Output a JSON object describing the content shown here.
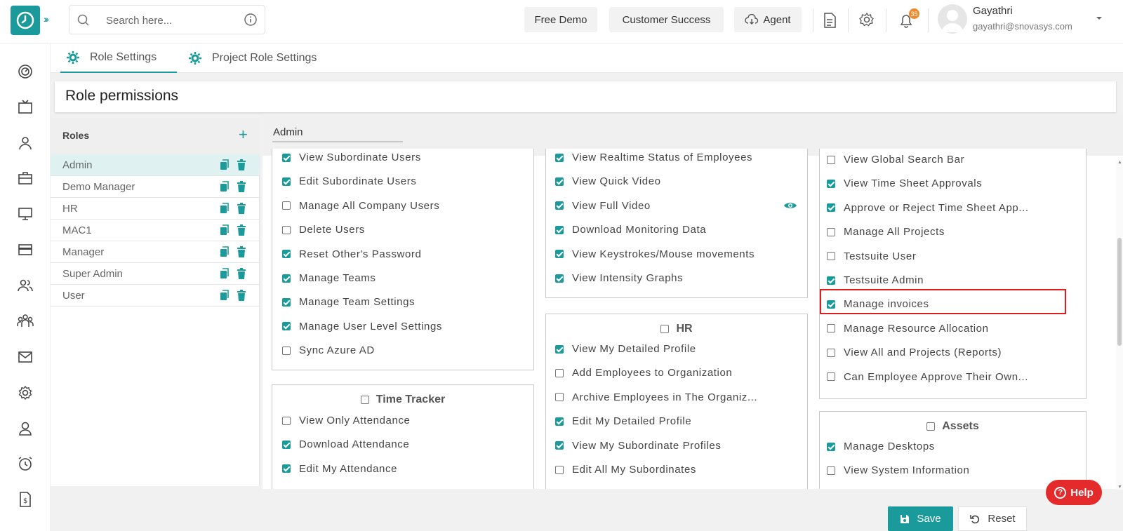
{
  "header": {
    "search_placeholder": "Search here...",
    "buttons": {
      "free_demo": "Free Demo",
      "customer_success": "Customer Success",
      "agent": "Agent"
    },
    "notification_count": "35",
    "user": {
      "name": "Gayathri",
      "email": "gayathri@snovasys.com"
    }
  },
  "tabs": [
    {
      "label": "Role Settings",
      "active": true
    },
    {
      "label": "Project Role Settings",
      "active": false
    }
  ],
  "page_title": "Role permissions",
  "roles_panel": {
    "title": "Roles",
    "roles": [
      "Admin",
      "Demo Manager",
      "HR",
      "MAC1",
      "Manager",
      "Super Admin",
      "User"
    ],
    "selected": "Admin"
  },
  "permissions": {
    "role_name": "Admin",
    "col1_box1": [
      {
        "label": "View Subordinate Users",
        "checked": true
      },
      {
        "label": "Edit Subordinate Users",
        "checked": true
      },
      {
        "label": "Manage All Company Users",
        "checked": false
      },
      {
        "label": "Delete Users",
        "checked": false
      },
      {
        "label": "Reset Other's Password",
        "checked": true
      },
      {
        "label": "Manage Teams",
        "checked": true
      },
      {
        "label": "Manage Team Settings",
        "checked": true
      },
      {
        "label": "Manage User Level Settings",
        "checked": true
      },
      {
        "label": "Sync Azure AD",
        "checked": false
      }
    ],
    "time_tracker": {
      "title": "Time Tracker",
      "items": [
        {
          "label": "View Only Attendance",
          "checked": false
        },
        {
          "label": "Download Attendance",
          "checked": true
        },
        {
          "label": "Edit My Attendance",
          "checked": true
        }
      ]
    },
    "col2_box1": [
      {
        "label": "View Realtime Status of Employees",
        "checked": true
      },
      {
        "label": "View Quick Video",
        "checked": true
      },
      {
        "label": "View Full Video",
        "checked": true
      },
      {
        "label": "Download Monitoring Data",
        "checked": true
      },
      {
        "label": "View Keystrokes/Mouse movements",
        "checked": true
      },
      {
        "label": "View Intensity Graphs",
        "checked": true
      }
    ],
    "hr": {
      "title": "HR",
      "items": [
        {
          "label": "View My Detailed Profile",
          "checked": true
        },
        {
          "label": "Add Employees to Organization",
          "checked": false
        },
        {
          "label": "Archive Employees in The Organiz...",
          "checked": false
        },
        {
          "label": "Edit My Detailed Profile",
          "checked": true
        },
        {
          "label": "View My Subordinate Profiles",
          "checked": true
        },
        {
          "label": "Edit All My Subordinates",
          "checked": false
        }
      ]
    },
    "col3_box1": [
      {
        "label": "View Global Search Bar",
        "checked": false
      },
      {
        "label": "View Time Sheet Approvals",
        "checked": true
      },
      {
        "label": "Approve or Reject Time Sheet App...",
        "checked": true
      },
      {
        "label": "Manage All Projects",
        "checked": false
      },
      {
        "label": "Testsuite User",
        "checked": false
      },
      {
        "label": "Testsuite Admin",
        "checked": true
      },
      {
        "label": "Manage invoices",
        "checked": true
      },
      {
        "label": "Manage Resource Allocation",
        "checked": false
      },
      {
        "label": "View All and Projects (Reports)",
        "checked": false
      },
      {
        "label": "Can Employee Approve Their Own...",
        "checked": false
      }
    ],
    "assets": {
      "title": "Assets",
      "items": [
        {
          "label": "Manage Desktops",
          "checked": true
        },
        {
          "label": "View System Information",
          "checked": false
        }
      ]
    }
  },
  "actions": {
    "save": "Save",
    "reset": "Reset",
    "help": "Help"
  },
  "colors": {
    "accent": "#1a9a9a",
    "highlight": "#e21c1c",
    "help": "#e42a2a",
    "badge": "#f0892b"
  }
}
